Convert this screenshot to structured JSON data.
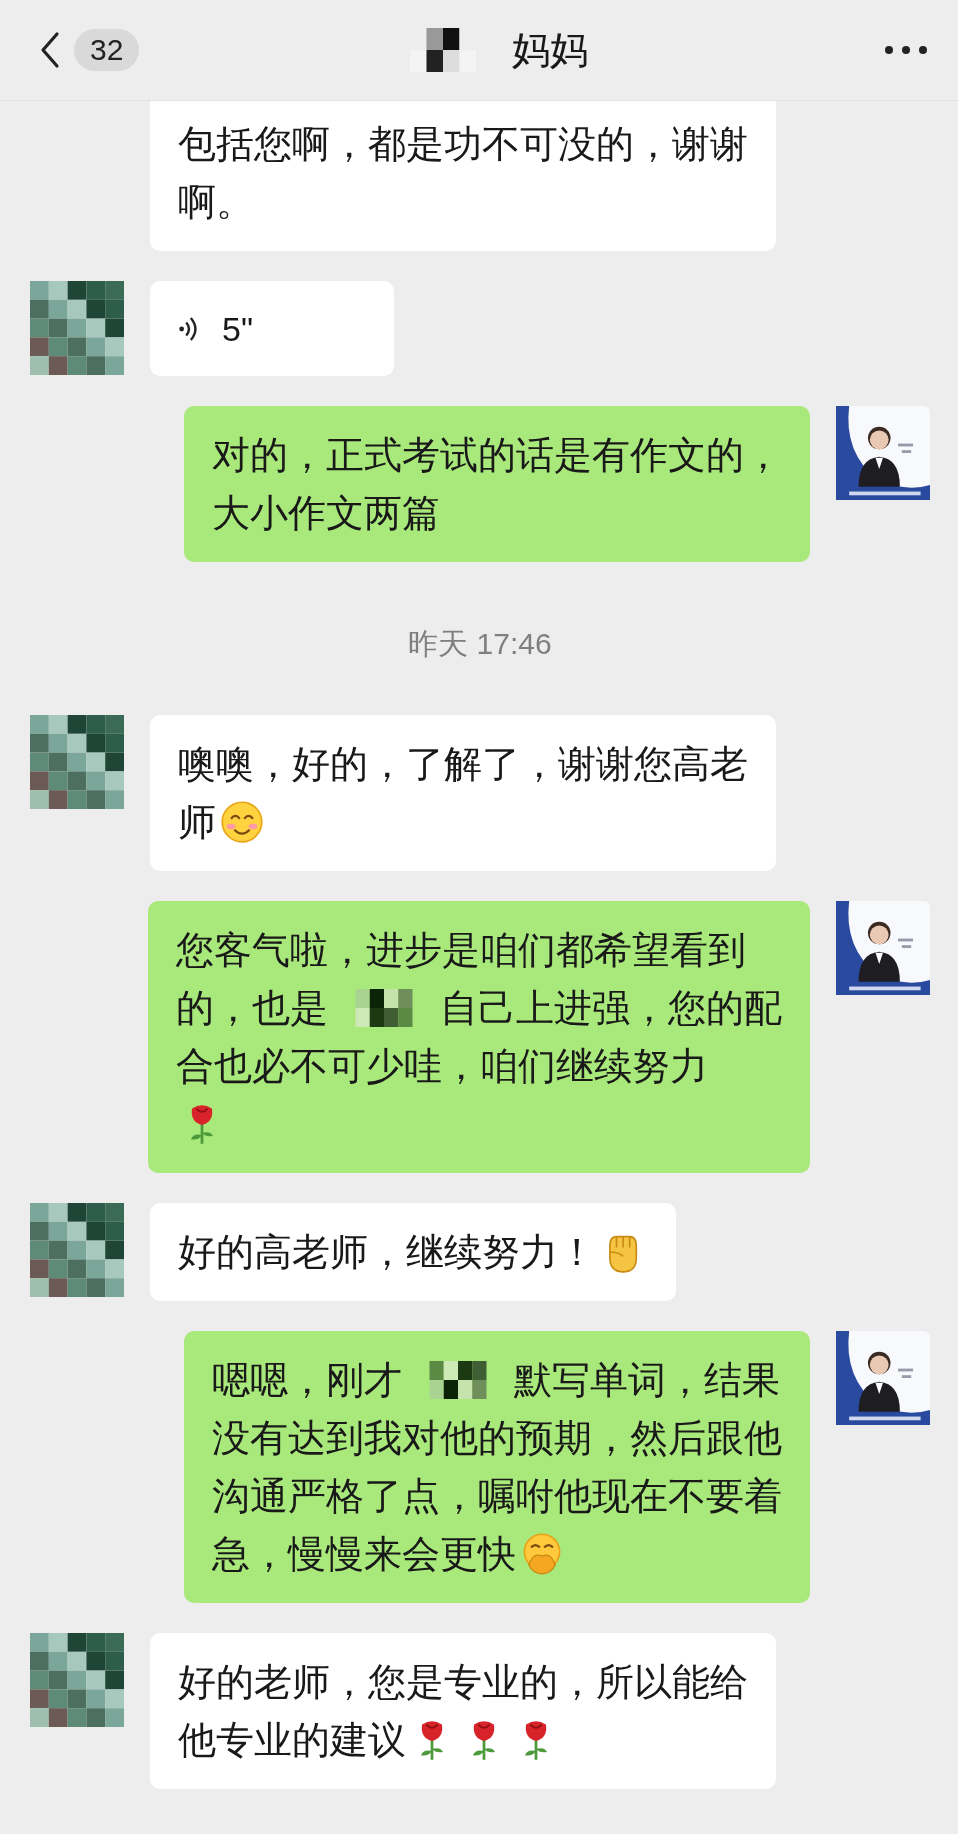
{
  "header": {
    "back_count": "32",
    "title": [
      {
        "kind": "mosaic"
      },
      {
        "kind": "text",
        "text": "妈妈"
      }
    ]
  },
  "messages": [
    {
      "kind": "text",
      "outgoing": false,
      "avatar": false,
      "lines": [
        [
          {
            "kind": "text",
            "text": "包括您啊，都是功不可没的，谢谢"
          }
        ],
        [
          {
            "kind": "text",
            "text": "啊。"
          }
        ]
      ]
    },
    {
      "kind": "voice",
      "outgoing": false,
      "avatar": true,
      "duration": "5\""
    },
    {
      "kind": "text",
      "outgoing": true,
      "avatar": true,
      "lines": [
        [
          {
            "kind": "text",
            "text": "对的，正式考试的话是有作文的，"
          }
        ],
        [
          {
            "kind": "text",
            "text": "大小作文两篇"
          }
        ]
      ]
    },
    {
      "kind": "time",
      "text": "昨天 17:46"
    },
    {
      "kind": "text",
      "outgoing": false,
      "avatar": true,
      "lines": [
        [
          {
            "kind": "text",
            "text": "噢噢，好的，了解了，谢谢您高老"
          }
        ],
        [
          {
            "kind": "text",
            "text": "师"
          },
          {
            "kind": "smile"
          }
        ]
      ]
    },
    {
      "kind": "text",
      "outgoing": true,
      "avatar": true,
      "lines": [
        [
          {
            "kind": "text",
            "text": "您客气啦，进步是咱们都希望看到"
          }
        ],
        [
          {
            "kind": "text",
            "text": "的，也是"
          },
          {
            "kind": "mosaic"
          },
          {
            "kind": "text",
            "text": "自己上进强，您的配"
          }
        ],
        [
          {
            "kind": "text",
            "text": "合也必不可少哇，咱们继续努力"
          }
        ],
        [
          {
            "kind": "rose"
          }
        ]
      ]
    },
    {
      "kind": "text",
      "outgoing": false,
      "avatar": true,
      "lines": [
        [
          {
            "kind": "text",
            "text": "好的高老师，继续努力！"
          },
          {
            "kind": "fist"
          }
        ]
      ]
    },
    {
      "kind": "text",
      "outgoing": true,
      "avatar": true,
      "lines": [
        [
          {
            "kind": "text",
            "text": "嗯嗯，刚才"
          },
          {
            "kind": "mosaic"
          },
          {
            "kind": "text",
            "text": "默写单词，结果"
          }
        ],
        [
          {
            "kind": "text",
            "text": "没有达到我对他的预期，然后跟他"
          }
        ],
        [
          {
            "kind": "text",
            "text": "沟通严格了点，嘱咐他现在不要着"
          }
        ],
        [
          {
            "kind": "text",
            "text": "急，慢慢来会更快"
          },
          {
            "kind": "giggle"
          }
        ]
      ]
    },
    {
      "kind": "text",
      "outgoing": false,
      "avatar": true,
      "lines": [
        [
          {
            "kind": "text",
            "text": "好的老师，您是专业的，所以能给"
          }
        ],
        [
          {
            "kind": "text",
            "text": "他专业的建议"
          },
          {
            "kind": "rose"
          },
          {
            "kind": "rose"
          },
          {
            "kind": "rose"
          }
        ]
      ]
    }
  ]
}
